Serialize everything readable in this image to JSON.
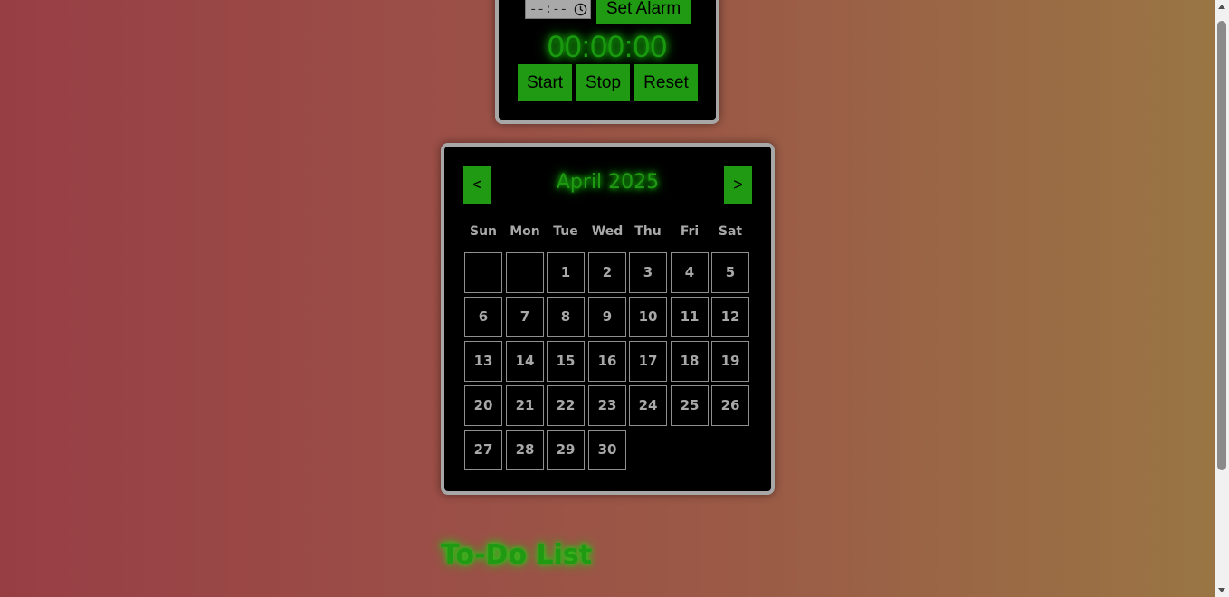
{
  "timer": {
    "time_input_value": "--:--",
    "set_alarm_label": "Set Alarm",
    "display": "00:00:00",
    "start_label": "Start",
    "stop_label": "Stop",
    "reset_label": "Reset"
  },
  "calendar": {
    "prev_label": "<",
    "next_label": ">",
    "month_title": "April 2025",
    "weekdays": [
      "Sun",
      "Mon",
      "Tue",
      "Wed",
      "Thu",
      "Fri",
      "Sat"
    ],
    "leading_blank_days": 2,
    "days": [
      "1",
      "2",
      "3",
      "4",
      "5",
      "6",
      "7",
      "8",
      "9",
      "10",
      "11",
      "12",
      "13",
      "14",
      "15",
      "16",
      "17",
      "18",
      "19",
      "20",
      "21",
      "22",
      "23",
      "24",
      "25",
      "26",
      "27",
      "28",
      "29",
      "30"
    ]
  },
  "todo": {
    "title": "To-Do List"
  },
  "colors": {
    "accent_green": "#1f9a12",
    "panel_bg": "#000000",
    "panel_border": "#a7a7a7",
    "day_text": "#a8a8a8"
  }
}
